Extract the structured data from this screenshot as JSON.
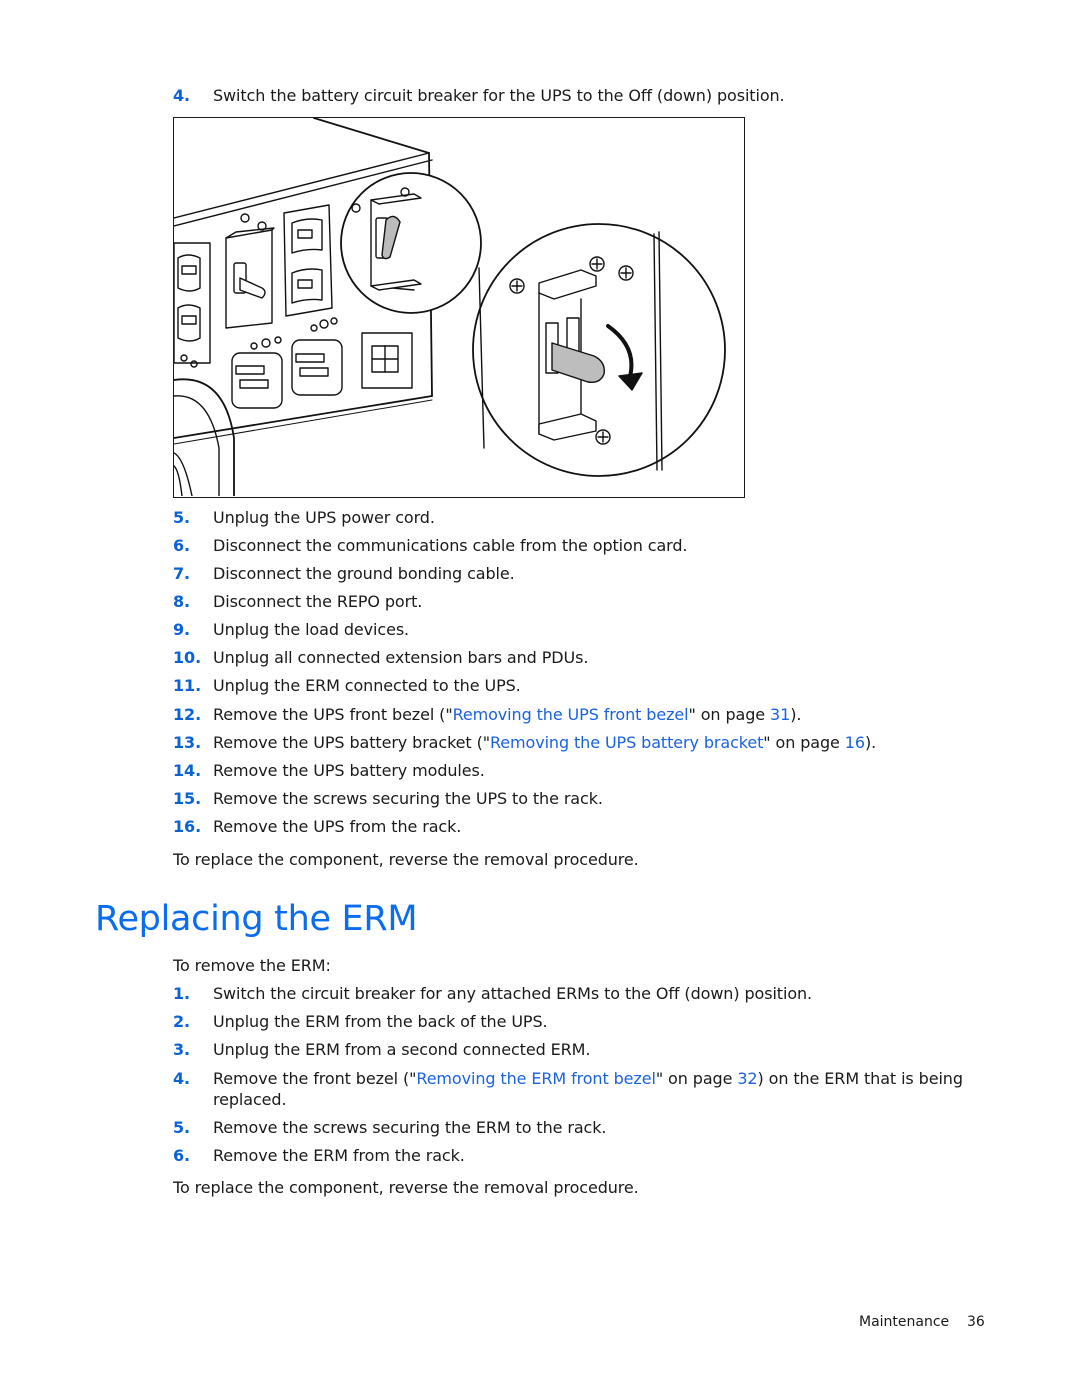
{
  "steps_top": [
    {
      "num": "4.",
      "text": "Switch the battery circuit breaker for the UPS to the Off (down) position."
    }
  ],
  "figure": {
    "description": "UPS rear panel with battery circuit breaker magnified, arrow showing switch moved to Off (down) position",
    "icons": [
      "ups-rear-panel",
      "circuit-breaker-toggle",
      "rotate-down-arrow",
      "magnifier-circle"
    ]
  },
  "steps_ups": [
    {
      "num": "5.",
      "text": "Unplug the UPS power cord."
    },
    {
      "num": "6.",
      "text": "Disconnect the communications cable from the option card."
    },
    {
      "num": "7.",
      "text": "Disconnect the ground bonding cable."
    },
    {
      "num": "8.",
      "text": "Disconnect the REPO port."
    },
    {
      "num": "9.",
      "text": "Unplug the load devices."
    },
    {
      "num": "10.",
      "text": "Unplug all connected extension bars and PDUs."
    },
    {
      "num": "11.",
      "text": "Unplug the ERM connected to the UPS."
    },
    {
      "num": "12.",
      "pre": "Remove the UPS front bezel (\"",
      "link": "Removing the UPS front bezel",
      "mid": "\" on page ",
      "page": "31",
      "post": ")."
    },
    {
      "num": "13.",
      "pre": "Remove the UPS battery bracket (\"",
      "link": "Removing the UPS battery bracket",
      "mid": "\" on page ",
      "page": "16",
      "post": ")."
    },
    {
      "num": "14.",
      "text": "Remove the UPS battery modules."
    },
    {
      "num": "15.",
      "text": "Remove the screws securing the UPS to the rack."
    },
    {
      "num": "16.",
      "text": "Remove the UPS from the rack."
    }
  ],
  "replace_note_1": "To replace the component, reverse the removal procedure.",
  "section": {
    "heading": "Replacing the ERM",
    "intro": "To remove the ERM:",
    "steps": [
      {
        "num": "1.",
        "text": "Switch the circuit breaker for any attached ERMs to the Off (down) position."
      },
      {
        "num": "2.",
        "text": "Unplug the ERM from the back of the UPS."
      },
      {
        "num": "3.",
        "text": "Unplug the ERM from a second connected ERM."
      },
      {
        "num": "4.",
        "pre": "Remove the front bezel (\"",
        "link": "Removing the ERM front bezel",
        "mid": "\" on page ",
        "page": "32",
        "post": ") on the ERM that is being",
        "line2": "replaced."
      },
      {
        "num": "5.",
        "text": "Remove the screws securing the ERM to the rack."
      },
      {
        "num": "6.",
        "text": "Remove the ERM from the rack."
      }
    ],
    "replace_note": "To replace the component, reverse the removal procedure."
  },
  "footer": {
    "section": "Maintenance",
    "page": "36"
  },
  "colors": {
    "heading": "#0a6cf0",
    "step_number": "#0a63d6",
    "link": "#1a63e0",
    "text": "#1a1a1a"
  }
}
